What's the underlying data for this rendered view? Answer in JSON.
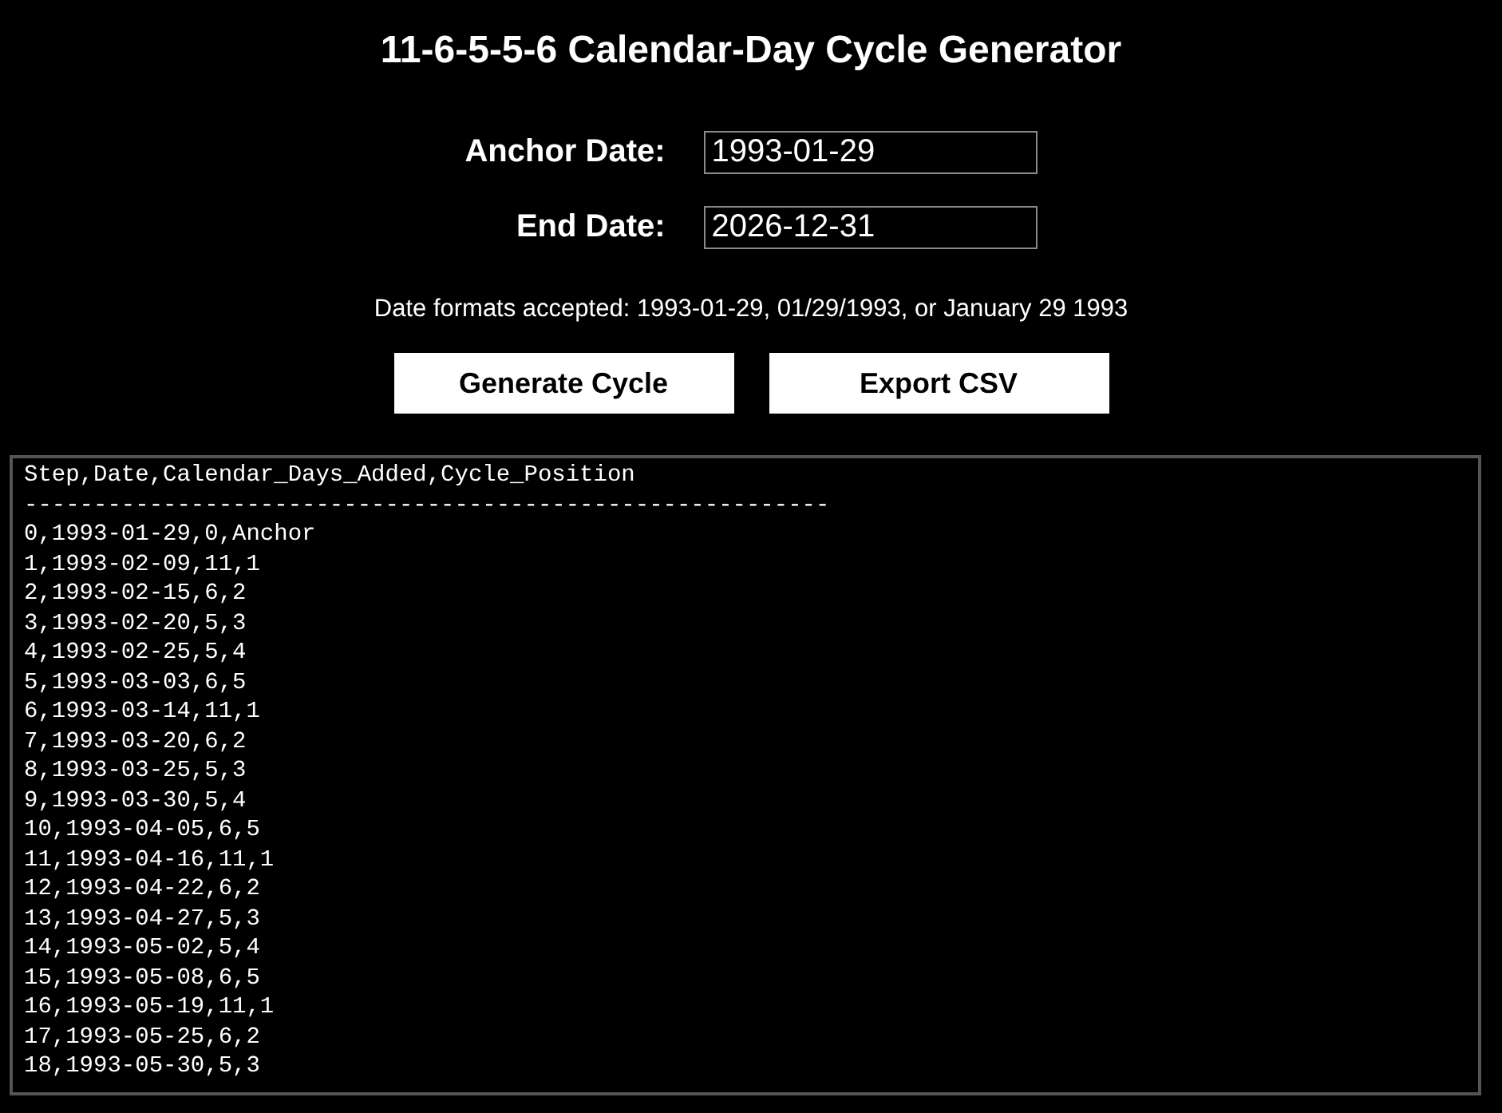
{
  "title": "11-6-5-5-6 Calendar-Day Cycle Generator",
  "fields": [
    {
      "label": "Anchor Date:",
      "value": "1993-01-29"
    },
    {
      "label": "End Date:",
      "value": "2026-12-31"
    }
  ],
  "hint": "Date formats accepted: 1993-01-29, 01/29/1993, or January 29 1993",
  "buttons": [
    "Generate Cycle",
    "Export CSV"
  ],
  "output": {
    "lines": [
      "Step,Date,Calendar_Days_Added,Cycle_Position",
      "----------------------------------------------------------",
      "0,1993-01-29,0,Anchor",
      "1,1993-02-09,11,1",
      "2,1993-02-15,6,2",
      "3,1993-02-20,5,3",
      "4,1993-02-25,5,4",
      "5,1993-03-03,6,5",
      "6,1993-03-14,11,1",
      "7,1993-03-20,6,2",
      "8,1993-03-25,5,3",
      "9,1993-03-30,5,4",
      "10,1993-04-05,6,5",
      "11,1993-04-16,11,1",
      "12,1993-04-22,6,2",
      "13,1993-04-27,5,3",
      "14,1993-05-02,5,4",
      "15,1993-05-08,6,5",
      "16,1993-05-19,11,1",
      "17,1993-05-25,6,2",
      "18,1993-05-30,5,3"
    ]
  }
}
